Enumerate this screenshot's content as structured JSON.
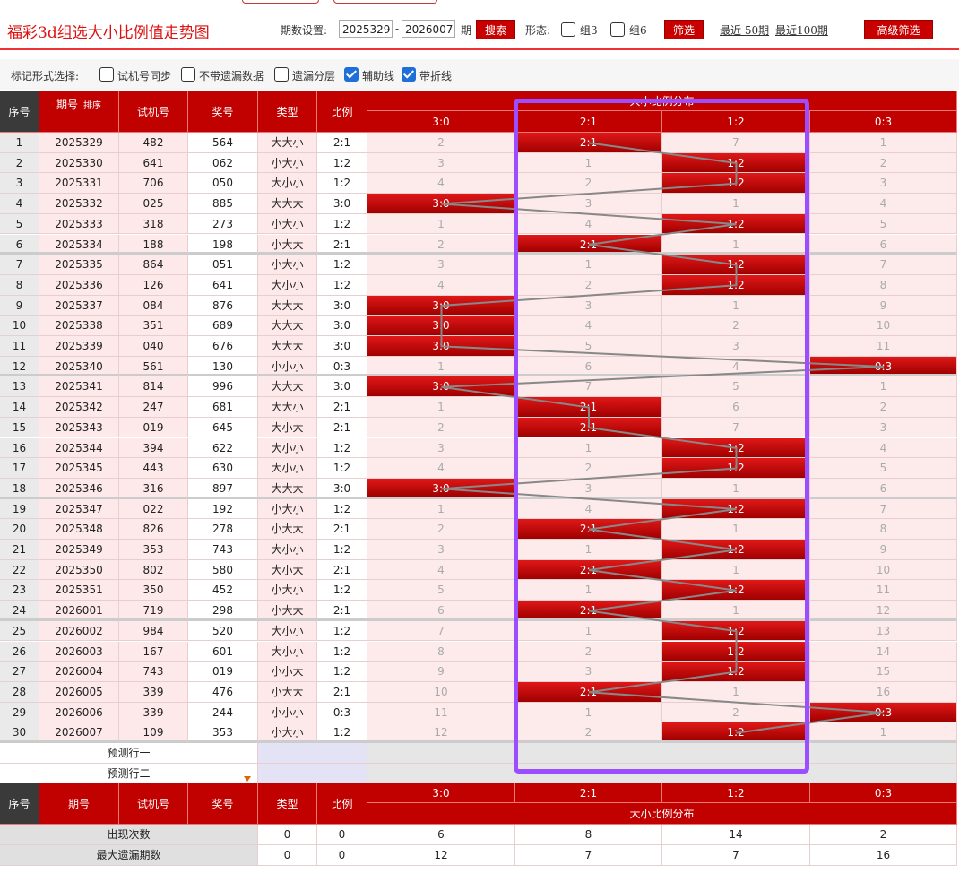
{
  "header": {
    "title": "福彩3d组选大小比例值走势图",
    "period_label": "期数设置:",
    "period_from": "2025329",
    "period_to": "2026007",
    "period_unit": "期",
    "search_label": "搜索",
    "form_label": "形态:",
    "group3_label": "组3",
    "group6_label": "组6",
    "filter_label": "筛选",
    "recent50": "最近 50期",
    "recent100": "最近100期",
    "advanced_label": "高级筛选"
  },
  "markbar": {
    "title": "标记形式选择:",
    "options": [
      {
        "label": "试机号同步",
        "checked": false
      },
      {
        "label": "不带遗漏数据",
        "checked": false
      },
      {
        "label": "遗漏分层",
        "checked": false
      },
      {
        "label": "辅助线",
        "checked": true
      },
      {
        "label": "带折线",
        "checked": true
      }
    ]
  },
  "table": {
    "headers": {
      "seq": "序号",
      "period": "期号",
      "sort": "排序",
      "trial": "试机号",
      "prize": "奖号",
      "type": "类型",
      "ratio": "比例",
      "group": "大小比例分布"
    },
    "ratio_columns": [
      "3:0",
      "2:1",
      "1:2",
      "0:3"
    ],
    "rows": [
      {
        "seq": "1",
        "period": "2025329",
        "trial": "482",
        "prize": "564",
        "type": "大大小",
        "ratio": "2:1",
        "cells": [
          "2",
          "2:1",
          "7",
          "1"
        ]
      },
      {
        "seq": "2",
        "period": "2025330",
        "trial": "641",
        "prize": "062",
        "type": "小大小",
        "ratio": "1:2",
        "cells": [
          "3",
          "1",
          "1:2",
          "2"
        ]
      },
      {
        "seq": "3",
        "period": "2025331",
        "trial": "706",
        "prize": "050",
        "type": "大小小",
        "ratio": "1:2",
        "cells": [
          "4",
          "2",
          "1:2",
          "3"
        ]
      },
      {
        "seq": "4",
        "period": "2025332",
        "trial": "025",
        "prize": "885",
        "type": "大大大",
        "ratio": "3:0",
        "cells": [
          "3:0",
          "3",
          "1",
          "4"
        ]
      },
      {
        "seq": "5",
        "period": "2025333",
        "trial": "318",
        "prize": "273",
        "type": "小大小",
        "ratio": "1:2",
        "cells": [
          "1",
          "4",
          "1:2",
          "5"
        ]
      },
      {
        "seq": "6",
        "period": "2025334",
        "trial": "188",
        "prize": "198",
        "type": "小大大",
        "ratio": "2:1",
        "cells": [
          "2",
          "2:1",
          "1",
          "6"
        ]
      },
      {
        "seq": "7",
        "period": "2025335",
        "trial": "864",
        "prize": "051",
        "type": "小大小",
        "ratio": "1:2",
        "cells": [
          "3",
          "1",
          "1:2",
          "7"
        ]
      },
      {
        "seq": "8",
        "period": "2025336",
        "trial": "126",
        "prize": "641",
        "type": "大小小",
        "ratio": "1:2",
        "cells": [
          "4",
          "2",
          "1:2",
          "8"
        ]
      },
      {
        "seq": "9",
        "period": "2025337",
        "trial": "084",
        "prize": "876",
        "type": "大大大",
        "ratio": "3:0",
        "cells": [
          "3:0",
          "3",
          "1",
          "9"
        ]
      },
      {
        "seq": "10",
        "period": "2025338",
        "trial": "351",
        "prize": "689",
        "type": "大大大",
        "ratio": "3:0",
        "cells": [
          "3:0",
          "4",
          "2",
          "10"
        ]
      },
      {
        "seq": "11",
        "period": "2025339",
        "trial": "040",
        "prize": "676",
        "type": "大大大",
        "ratio": "3:0",
        "cells": [
          "3:0",
          "5",
          "3",
          "11"
        ]
      },
      {
        "seq": "12",
        "period": "2025340",
        "trial": "561",
        "prize": "130",
        "type": "小小小",
        "ratio": "0:3",
        "cells": [
          "1",
          "6",
          "4",
          "0:3"
        ]
      },
      {
        "seq": "13",
        "period": "2025341",
        "trial": "814",
        "prize": "996",
        "type": "大大大",
        "ratio": "3:0",
        "cells": [
          "3:0",
          "7",
          "5",
          "1"
        ]
      },
      {
        "seq": "14",
        "period": "2025342",
        "trial": "247",
        "prize": "681",
        "type": "大大小",
        "ratio": "2:1",
        "cells": [
          "1",
          "2:1",
          "6",
          "2"
        ]
      },
      {
        "seq": "15",
        "period": "2025343",
        "trial": "019",
        "prize": "645",
        "type": "大小大",
        "ratio": "2:1",
        "cells": [
          "2",
          "2:1",
          "7",
          "3"
        ]
      },
      {
        "seq": "16",
        "period": "2025344",
        "trial": "394",
        "prize": "622",
        "type": "大小小",
        "ratio": "1:2",
        "cells": [
          "3",
          "1",
          "1:2",
          "4"
        ]
      },
      {
        "seq": "17",
        "period": "2025345",
        "trial": "443",
        "prize": "630",
        "type": "大小小",
        "ratio": "1:2",
        "cells": [
          "4",
          "2",
          "1:2",
          "5"
        ]
      },
      {
        "seq": "18",
        "period": "2025346",
        "trial": "316",
        "prize": "897",
        "type": "大大大",
        "ratio": "3:0",
        "cells": [
          "3:0",
          "3",
          "1",
          "6"
        ]
      },
      {
        "seq": "19",
        "period": "2025347",
        "trial": "022",
        "prize": "192",
        "type": "小大小",
        "ratio": "1:2",
        "cells": [
          "1",
          "4",
          "1:2",
          "7"
        ]
      },
      {
        "seq": "20",
        "period": "2025348",
        "trial": "826",
        "prize": "278",
        "type": "小大大",
        "ratio": "2:1",
        "cells": [
          "2",
          "2:1",
          "1",
          "8"
        ]
      },
      {
        "seq": "21",
        "period": "2025349",
        "trial": "353",
        "prize": "743",
        "type": "大小小",
        "ratio": "1:2",
        "cells": [
          "3",
          "1",
          "1:2",
          "9"
        ]
      },
      {
        "seq": "22",
        "period": "2025350",
        "trial": "802",
        "prize": "580",
        "type": "大小大",
        "ratio": "2:1",
        "cells": [
          "4",
          "2:1",
          "1",
          "10"
        ]
      },
      {
        "seq": "23",
        "period": "2025351",
        "trial": "350",
        "prize": "452",
        "type": "小大小",
        "ratio": "1:2",
        "cells": [
          "5",
          "1",
          "1:2",
          "11"
        ]
      },
      {
        "seq": "24",
        "period": "2026001",
        "trial": "719",
        "prize": "298",
        "type": "小大大",
        "ratio": "2:1",
        "cells": [
          "6",
          "2:1",
          "1",
          "12"
        ]
      },
      {
        "seq": "25",
        "period": "2026002",
        "trial": "984",
        "prize": "520",
        "type": "大小小",
        "ratio": "1:2",
        "cells": [
          "7",
          "1",
          "1:2",
          "13"
        ]
      },
      {
        "seq": "26",
        "period": "2026003",
        "trial": "167",
        "prize": "601",
        "type": "大小小",
        "ratio": "1:2",
        "cells": [
          "8",
          "2",
          "1:2",
          "14"
        ]
      },
      {
        "seq": "27",
        "period": "2026004",
        "trial": "743",
        "prize": "019",
        "type": "小小大",
        "ratio": "1:2",
        "cells": [
          "9",
          "3",
          "1:2",
          "15"
        ]
      },
      {
        "seq": "28",
        "period": "2026005",
        "trial": "339",
        "prize": "476",
        "type": "小大大",
        "ratio": "2:1",
        "cells": [
          "10",
          "2:1",
          "1",
          "16"
        ]
      },
      {
        "seq": "29",
        "period": "2026006",
        "trial": "339",
        "prize": "244",
        "type": "小小小",
        "ratio": "0:3",
        "cells": [
          "11",
          "1",
          "2",
          "0:3"
        ]
      },
      {
        "seq": "30",
        "period": "2026007",
        "trial": "109",
        "prize": "353",
        "type": "小大小",
        "ratio": "1:2",
        "cells": [
          "12",
          "2",
          "1:2",
          "1"
        ]
      }
    ],
    "predict": [
      "预测行一",
      "预测行二"
    ],
    "footer": [
      {
        "label": "出现次数",
        "type": "0",
        "ratio": "0",
        "values": [
          "6",
          "8",
          "14",
          "2"
        ]
      },
      {
        "label": "最大遗漏期数",
        "type": "0",
        "ratio": "0",
        "values": [
          "12",
          "7",
          "7",
          "16"
        ]
      }
    ]
  },
  "colors": {
    "accent": "#c10000",
    "highlight": "#9b4dff",
    "line": "#888888"
  }
}
